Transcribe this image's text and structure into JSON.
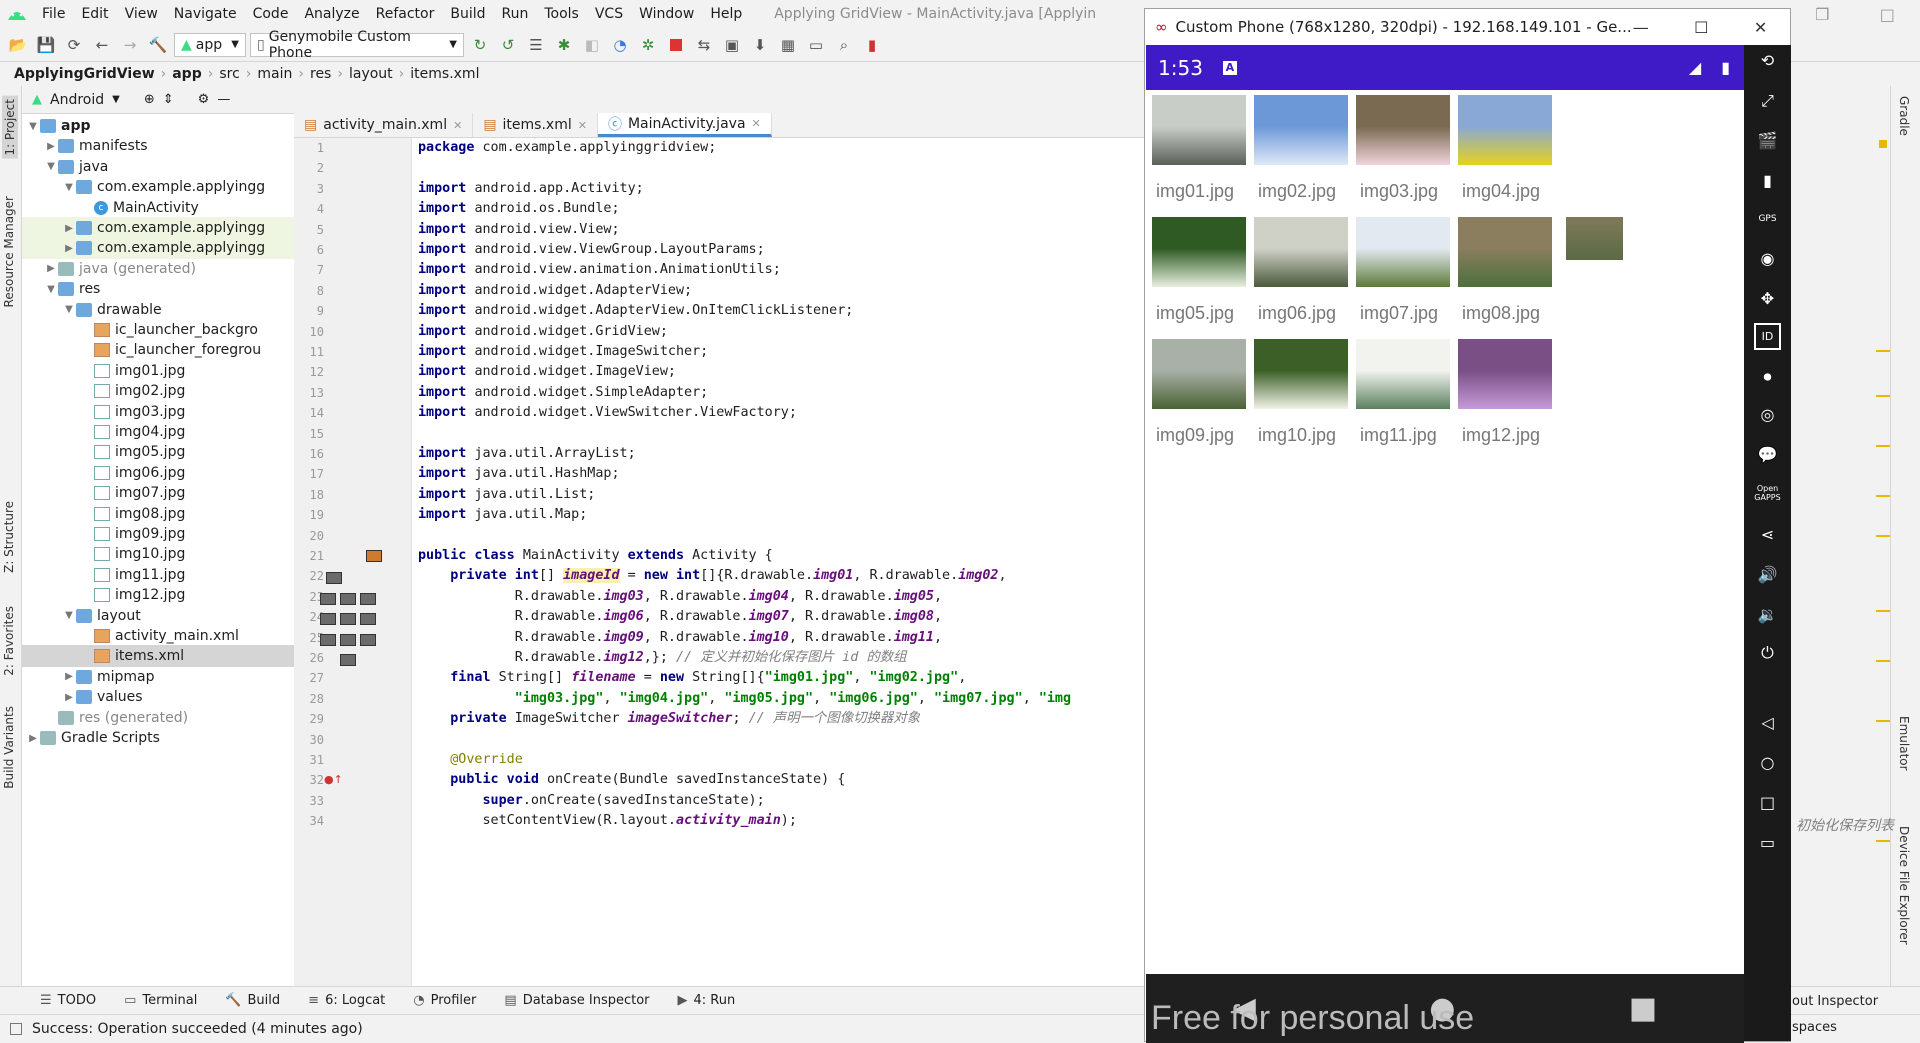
{
  "menu": {
    "items": [
      "File",
      "Edit",
      "View",
      "Navigate",
      "Code",
      "Analyze",
      "Refactor",
      "Build",
      "Run",
      "Tools",
      "VCS",
      "Window",
      "Help"
    ],
    "window_title": "Applying GridView - MainActivity.java [Applyin"
  },
  "toolbar": {
    "module_select": "app",
    "device_select": "Genymobile Custom Phone"
  },
  "breadcrumb": [
    "ApplyingGridView",
    "app",
    "src",
    "main",
    "res",
    "layout",
    "items.xml"
  ],
  "project": {
    "view_label": "Android",
    "tree": [
      {
        "label": "app",
        "level": 0,
        "arrow": "▼",
        "icon": "fold",
        "bold": true
      },
      {
        "label": "manifests",
        "level": 1,
        "arrow": "▶",
        "icon": "fold"
      },
      {
        "label": "java",
        "level": 1,
        "arrow": "▼",
        "icon": "fold"
      },
      {
        "label": "com.example.applyingg",
        "level": 2,
        "arrow": "▼",
        "icon": "fold"
      },
      {
        "label": "MainActivity",
        "level": 3,
        "arrow": "",
        "icon": "cls"
      },
      {
        "label": "com.example.applyingg",
        "level": 2,
        "arrow": "▶",
        "icon": "fold",
        "hl": true
      },
      {
        "label": "com.example.applyingg",
        "level": 2,
        "arrow": "▶",
        "icon": "fold",
        "hl": true
      },
      {
        "label": "java (generated)",
        "level": 1,
        "arrow": "▶",
        "icon": "fold-g",
        "gray": true
      },
      {
        "label": "res",
        "level": 1,
        "arrow": "▼",
        "icon": "fold"
      },
      {
        "label": "drawable",
        "level": 2,
        "arrow": "▼",
        "icon": "fold"
      },
      {
        "label": "ic_launcher_backgro",
        "level": 3,
        "arrow": "",
        "icon": "xml"
      },
      {
        "label": "ic_launcher_foregrou",
        "level": 3,
        "arrow": "",
        "icon": "xml"
      },
      {
        "label": "img01.jpg",
        "level": 3,
        "arrow": "",
        "icon": "img"
      },
      {
        "label": "img02.jpg",
        "level": 3,
        "arrow": "",
        "icon": "img"
      },
      {
        "label": "img03.jpg",
        "level": 3,
        "arrow": "",
        "icon": "img"
      },
      {
        "label": "img04.jpg",
        "level": 3,
        "arrow": "",
        "icon": "img"
      },
      {
        "label": "img05.jpg",
        "level": 3,
        "arrow": "",
        "icon": "img"
      },
      {
        "label": "img06.jpg",
        "level": 3,
        "arrow": "",
        "icon": "img"
      },
      {
        "label": "img07.jpg",
        "level": 3,
        "arrow": "",
        "icon": "img"
      },
      {
        "label": "img08.jpg",
        "level": 3,
        "arrow": "",
        "icon": "img"
      },
      {
        "label": "img09.jpg",
        "level": 3,
        "arrow": "",
        "icon": "img"
      },
      {
        "label": "img10.jpg",
        "level": 3,
        "arrow": "",
        "icon": "img"
      },
      {
        "label": "img11.jpg",
        "level": 3,
        "arrow": "",
        "icon": "img"
      },
      {
        "label": "img12.jpg",
        "level": 3,
        "arrow": "",
        "icon": "img"
      },
      {
        "label": "layout",
        "level": 2,
        "arrow": "▼",
        "icon": "fold"
      },
      {
        "label": "activity_main.xml",
        "level": 3,
        "arrow": "",
        "icon": "xml"
      },
      {
        "label": "items.xml",
        "level": 3,
        "arrow": "",
        "icon": "xml",
        "selected": true
      },
      {
        "label": "mipmap",
        "level": 2,
        "arrow": "▶",
        "icon": "fold"
      },
      {
        "label": "values",
        "level": 2,
        "arrow": "▶",
        "icon": "fold"
      },
      {
        "label": "res (generated)",
        "level": 1,
        "arrow": "",
        "icon": "fold-g",
        "gray": true
      },
      {
        "label": "Gradle Scripts",
        "level": 0,
        "arrow": "▶",
        "icon": "fold-g"
      }
    ]
  },
  "editor_tabs": [
    {
      "label": "activity_main.xml",
      "active": false
    },
    {
      "label": "items.xml",
      "active": false
    },
    {
      "label": "MainActivity.java",
      "active": true
    }
  ],
  "code_lines": [
    [
      [
        "kw",
        "package "
      ],
      [
        "",
        "com.example.applyinggridview;"
      ]
    ],
    [],
    [
      [
        "kw",
        "import "
      ],
      [
        "",
        "android.app.Activity;"
      ]
    ],
    [
      [
        "kw",
        "import "
      ],
      [
        "",
        "android.os.Bundle;"
      ]
    ],
    [
      [
        "kw",
        "import "
      ],
      [
        "",
        "android.view.View;"
      ]
    ],
    [
      [
        "kw",
        "import "
      ],
      [
        "",
        "android.view.ViewGroup.LayoutParams;"
      ]
    ],
    [
      [
        "kw",
        "import "
      ],
      [
        "",
        "android.view.animation.AnimationUtils;"
      ]
    ],
    [
      [
        "kw",
        "import "
      ],
      [
        "",
        "android.widget.AdapterView;"
      ]
    ],
    [
      [
        "kw",
        "import "
      ],
      [
        "",
        "android.widget.AdapterView.OnItemClickListener;"
      ]
    ],
    [
      [
        "kw",
        "import "
      ],
      [
        "",
        "android.widget.GridView;"
      ]
    ],
    [
      [
        "kw",
        "import "
      ],
      [
        "",
        "android.widget.ImageSwitcher;"
      ]
    ],
    [
      [
        "kw",
        "import "
      ],
      [
        "",
        "android.widget.ImageView;"
      ]
    ],
    [
      [
        "kw",
        "import "
      ],
      [
        "",
        "android.widget.SimpleAdapter;"
      ]
    ],
    [
      [
        "kw",
        "import "
      ],
      [
        "",
        "android.widget.ViewSwitcher.ViewFactory;"
      ]
    ],
    [],
    [
      [
        "kw",
        "import "
      ],
      [
        "",
        "java.util.ArrayList;"
      ]
    ],
    [
      [
        "kw",
        "import "
      ],
      [
        "",
        "java.util.HashMap;"
      ]
    ],
    [
      [
        "kw",
        "import "
      ],
      [
        "",
        "java.util.List;"
      ]
    ],
    [
      [
        "kw",
        "import "
      ],
      [
        "",
        "java.util.Map;"
      ]
    ],
    [],
    [
      [
        "kw",
        "public class "
      ],
      [
        "",
        "MainActivity "
      ],
      [
        "kw",
        "extends "
      ],
      [
        "",
        "Activity {"
      ]
    ],
    [
      [
        "",
        "    "
      ],
      [
        "kw",
        "private int"
      ],
      [
        "",
        "[] "
      ],
      [
        "fldh",
        "imageId"
      ],
      [
        "",
        " = "
      ],
      [
        "kw",
        "new int"
      ],
      [
        "",
        "[]{R.drawable."
      ],
      [
        "fld",
        "img01"
      ],
      [
        "",
        ", R.drawable."
      ],
      [
        "fld",
        "img02"
      ],
      [
        "",
        ","
      ]
    ],
    [
      [
        "",
        "            R.drawable."
      ],
      [
        "fld",
        "img03"
      ],
      [
        "",
        ", R.drawable."
      ],
      [
        "fld",
        "img04"
      ],
      [
        "",
        ", R.drawable."
      ],
      [
        "fld",
        "img05"
      ],
      [
        "",
        ","
      ]
    ],
    [
      [
        "",
        "            R.drawable."
      ],
      [
        "fld",
        "img06"
      ],
      [
        "",
        ", R.drawable."
      ],
      [
        "fld",
        "img07"
      ],
      [
        "",
        ", R.drawable."
      ],
      [
        "fld",
        "img08"
      ],
      [
        "",
        ","
      ]
    ],
    [
      [
        "",
        "            R.drawable."
      ],
      [
        "fld",
        "img09"
      ],
      [
        "",
        ", R.drawable."
      ],
      [
        "fld",
        "img10"
      ],
      [
        "",
        ", R.drawable."
      ],
      [
        "fld",
        "img11"
      ],
      [
        "",
        ","
      ]
    ],
    [
      [
        "",
        "            R.drawable."
      ],
      [
        "fld",
        "img12"
      ],
      [
        "",
        ",}; "
      ],
      [
        "cm",
        "// 定义并初始化保存图片 id 的数组"
      ]
    ],
    [
      [
        "",
        "    "
      ],
      [
        "kw",
        "final "
      ],
      [
        "",
        "String[] "
      ],
      [
        "fld",
        "filename"
      ],
      [
        "",
        " = "
      ],
      [
        "kw",
        "new "
      ],
      [
        "",
        "String[]{"
      ],
      [
        "str",
        "\"img01.jpg\""
      ],
      [
        "",
        ", "
      ],
      [
        "str",
        "\"img02.jpg\""
      ],
      [
        "",
        ","
      ]
    ],
    [
      [
        "",
        "            "
      ],
      [
        "str",
        "\"img03.jpg\""
      ],
      [
        "",
        ", "
      ],
      [
        "str",
        "\"img04.jpg\""
      ],
      [
        "",
        ", "
      ],
      [
        "str",
        "\"img05.jpg\""
      ],
      [
        "",
        ", "
      ],
      [
        "str",
        "\"img06.jpg\""
      ],
      [
        "",
        ", "
      ],
      [
        "str",
        "\"img07.jpg\""
      ],
      [
        "",
        ", "
      ],
      [
        "str",
        "\"img"
      ]
    ],
    [
      [
        "",
        "    "
      ],
      [
        "kw",
        "private "
      ],
      [
        "",
        "ImageSwitcher "
      ],
      [
        "fld",
        "imageSwitcher"
      ],
      [
        "",
        "; "
      ],
      [
        "cm",
        "// 声明一个图像切换器对象"
      ]
    ],
    [],
    [
      [
        "",
        "    "
      ],
      [
        "ann",
        "@Override"
      ]
    ],
    [
      [
        "",
        "    "
      ],
      [
        "kw",
        "public void "
      ],
      [
        "",
        "onCreate(Bundle savedInstanceState) {"
      ]
    ],
    [
      [
        "",
        "        "
      ],
      [
        "kw",
        "super"
      ],
      [
        "",
        ".onCreate(savedInstanceState);"
      ]
    ],
    [
      [
        "",
        "        setContentView(R.layout."
      ],
      [
        "fld",
        "activity_main"
      ],
      [
        "",
        ");"
      ]
    ]
  ],
  "code_overflow_comment": "初始化保存列表",
  "emulator": {
    "window_title": "Custom Phone (768x1280, 320dpi) - 192.168.149.101 - Ge...",
    "time": "1:53",
    "items": [
      {
        "label": "img01.jpg",
        "colors": [
          "#c9cdc8",
          "#5a5f58"
        ]
      },
      {
        "label": "img02.jpg",
        "colors": [
          "#6d98d8",
          "#dfe9f6"
        ]
      },
      {
        "label": "img03.jpg",
        "colors": [
          "#7a6a52",
          "#f1d4dd"
        ]
      },
      {
        "label": "img04.jpg",
        "colors": [
          "#8aa8d6",
          "#e6d220"
        ]
      },
      {
        "label": "img05.jpg",
        "colors": [
          "#2f5a24",
          "#e8efe0"
        ]
      },
      {
        "label": "img06.jpg",
        "colors": [
          "#cfd1c7",
          "#4b5a3a"
        ]
      },
      {
        "label": "img07.jpg",
        "colors": [
          "#e3e9f0",
          "#5d7a3a"
        ]
      },
      {
        "label": "img08.jpg",
        "colors": [
          "#8a7e5e",
          "#4e6f3c"
        ]
      },
      {
        "label": "img09.jpg",
        "colors": [
          "#a9b0a8",
          "#4a6235"
        ]
      },
      {
        "label": "img10.jpg",
        "colors": [
          "#3b5f26",
          "#f2f2e8"
        ]
      },
      {
        "label": "img11.jpg",
        "colors": [
          "#f2f3ef",
          "#5a7f5e"
        ]
      },
      {
        "label": "img12.jpg",
        "colors": [
          "#7a4f86",
          "#c79bd8"
        ]
      }
    ],
    "watermark": "Free for personal use",
    "side_icons": [
      "rotate-icon",
      "fullscreen-icon",
      "camera-icon",
      "battery-icon",
      "gps-icon",
      "webcam-icon",
      "dpad-icon",
      "id-icon",
      "capture-icon",
      "broadcast-icon",
      "sms-icon",
      "open-gapps-icon",
      "share-icon",
      "volume-up-icon",
      "volume-down-icon",
      "power-icon",
      "back-icon",
      "home-icon",
      "recents-icon",
      "menu-icon"
    ],
    "gps_label": "GPS",
    "gapps_label": "Open GAPPS",
    "id_label": "ID"
  },
  "left_tabs": [
    "1: Project",
    "Resource Manager",
    "Z: Structure",
    "2: Favorites",
    "Build Variants"
  ],
  "right_tabs": [
    "Gradle",
    "Emulator",
    "Device File Explorer"
  ],
  "bottom_tools": [
    "TODO",
    "Terminal",
    "Build",
    "6: Logcat",
    "Profiler",
    "Database Inspector",
    "4: Run"
  ],
  "bottom_right": {
    "inspector": "out Inspector",
    "spaces": "spaces"
  },
  "status": "Success: Operation succeeded (4 minutes ago)"
}
